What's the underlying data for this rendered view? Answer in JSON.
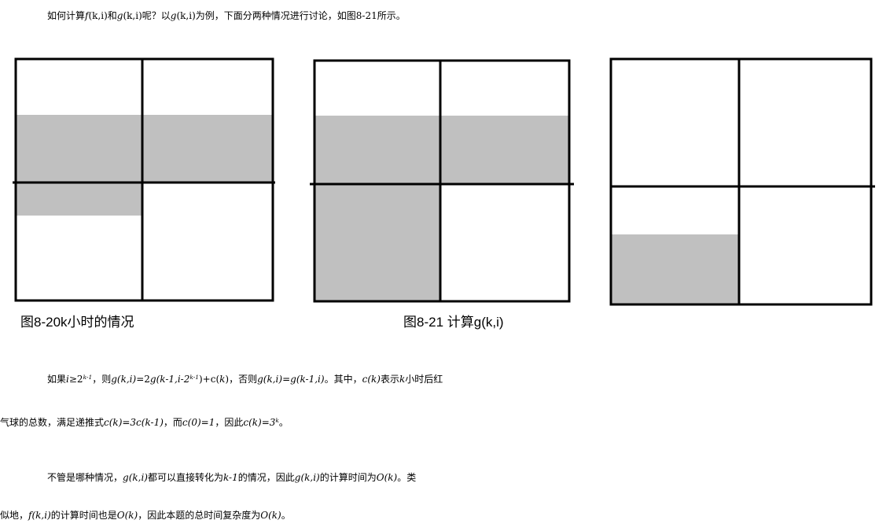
{
  "intro": {
    "t1": "如何计算",
    "f": "f",
    "f_args": "(k,i)",
    "t2": "和",
    "g": "g",
    "g_args": "(k,i)",
    "t3": "呢？以",
    "g2": "g",
    "g2_args": "(k,i)",
    "t4": "为例，下面分两种情况进行讨论，如图",
    "fig_ref": "8-21",
    "t5": "所示。"
  },
  "figures": {
    "caption_left": "图8-20k小时的情况",
    "caption_middle": "图8-21    计算g(k,i)",
    "fill_color": "#c0c0c0",
    "line_color": "#000000"
  },
  "para1": {
    "line1": {
      "t1": "如果",
      "cond_i": "i",
      "cond_ge": "≥2",
      "cond_exp": "k-1",
      "t2": "，则",
      "eq1_g": "g",
      "eq1_args": "(k,i)",
      "eq1_eq": "=2",
      "eq1_g2": "g",
      "eq1_arg_a": "(k-1,i-2",
      "eq1_exp": "k-1",
      "eq1_arg_b": ")+c(",
      "eq1_k": "k",
      "eq1_close": ")",
      "t3": "，否则",
      "eq2": "g(k,i)=g(k-1,i)",
      "t4": "。其中，",
      "ck": "c(k)",
      "t5": "表示",
      "k": "k",
      "t6": "小时后红"
    },
    "line2": {
      "t1": "气球的总数，满足递推式",
      "rec": "c(k)=3c(k-1)",
      "t2": "，而",
      "c0": "c(0)=1",
      "t3": "，因此",
      "ck": "c(k)=3",
      "ck_exp": "k",
      "t4": "。"
    }
  },
  "para2": {
    "line1": {
      "t1": "不管是哪种情况，",
      "g1": "g(k,i)",
      "t2": "都可以直接转化为",
      "km1": "k-1",
      "t3": "的情况，因此",
      "g2": "g(k,i)",
      "t4": "的计算时间为",
      "ok": "O(k)",
      "t5": "。类"
    },
    "line2": {
      "t1": "似地，",
      "f": "f(k,i)",
      "t2": "的计算时间也是",
      "ok": "O(k)",
      "t3": "，因此本题的总时间复杂度为",
      "ok2": "O(k)",
      "t4": "。"
    }
  }
}
